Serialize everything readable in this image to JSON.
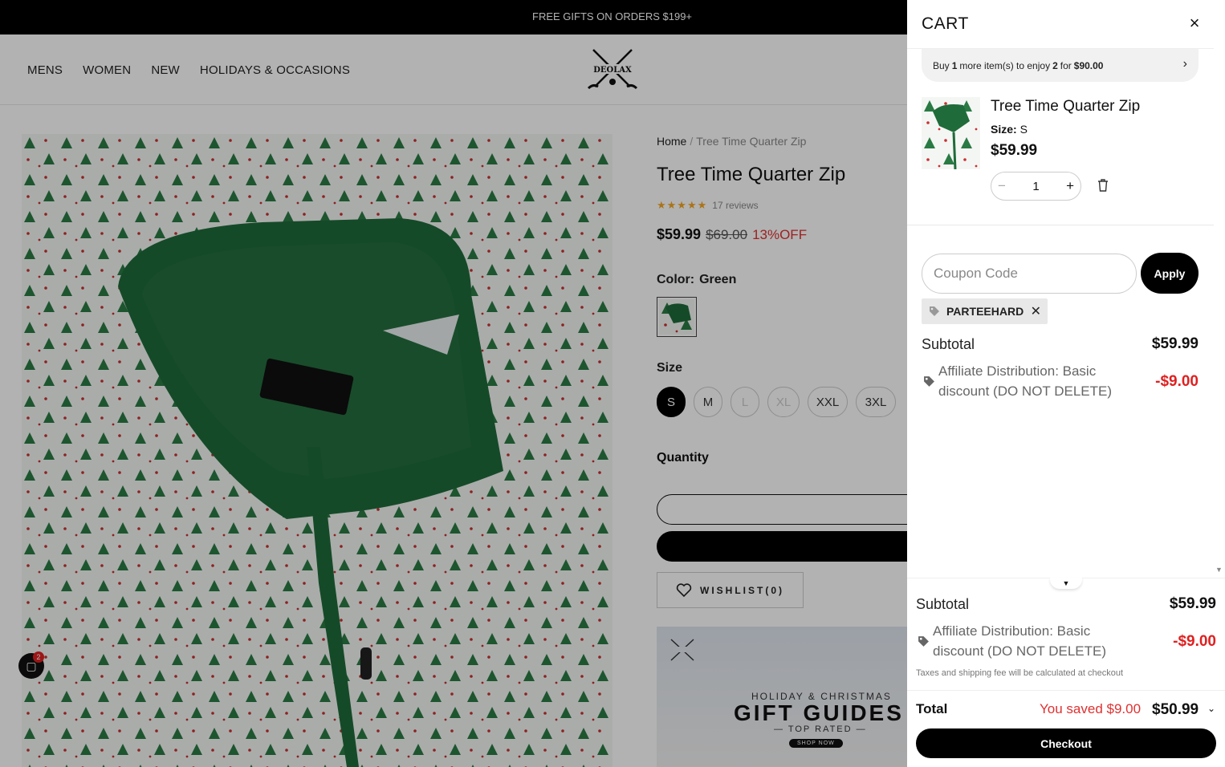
{
  "announcement": "FREE GIFTS ON ORDERS $199+",
  "nav": [
    "MENS",
    "WOMEN",
    "NEW",
    "HOLIDAYS & OCCASIONS"
  ],
  "logo_text": "DEOLAX",
  "product": {
    "breadcrumb_home": "Home",
    "breadcrumb_sep": "/",
    "breadcrumb_current": "Tree Time Quarter Zip",
    "title": "Tree Time Quarter Zip",
    "stars": "★★★★★",
    "reviews": "17 reviews",
    "price": "$59.99",
    "compare_price": "$69.00",
    "discount": "13%OFF",
    "color_label": "Color:",
    "color_value": "Green",
    "size_label": "Size",
    "sizes": [
      "S",
      "M",
      "L",
      "XL",
      "XXL",
      "3XL"
    ],
    "quantity_label": "Quantity",
    "wishlist": "WISHLIST(0)"
  },
  "banner": {
    "line1": "HOLIDAY & CHRISTMAS",
    "line2": "GIFT GUIDES",
    "line3": "— TOP RATED —",
    "cta": "SHOP NOW"
  },
  "chat_badge": "2",
  "cart": {
    "title": "CART",
    "close": "×",
    "upsell_pre": "Buy",
    "upsell_count": "1",
    "upsell_mid": "more item(s) to enjoy",
    "upsell_qty": "2",
    "upsell_for": "for",
    "upsell_price": "$90.00",
    "item": {
      "title": "Tree Time Quarter Zip",
      "size_label": "Size:",
      "size_value": "S",
      "price": "$59.99",
      "quantity": "1"
    },
    "coupon_placeholder": "Coupon Code",
    "apply": "Apply",
    "applied_code": "PARTEEHARD",
    "subtotal_label": "Subtotal",
    "subtotal": "$59.99",
    "discount_label": "Affiliate Distribution: Basic discount (DO NOT DELETE)",
    "discount_value": "-$9.00",
    "tax_note": "Taxes and shipping fee will be calculated at checkout",
    "total_label": "Total",
    "saved": "You saved $9.00",
    "total": "$50.99",
    "checkout": "Checkout"
  },
  "colors": {
    "accent_red": "#e02020",
    "brand_green": "#1f6b3a",
    "black": "#000000"
  }
}
